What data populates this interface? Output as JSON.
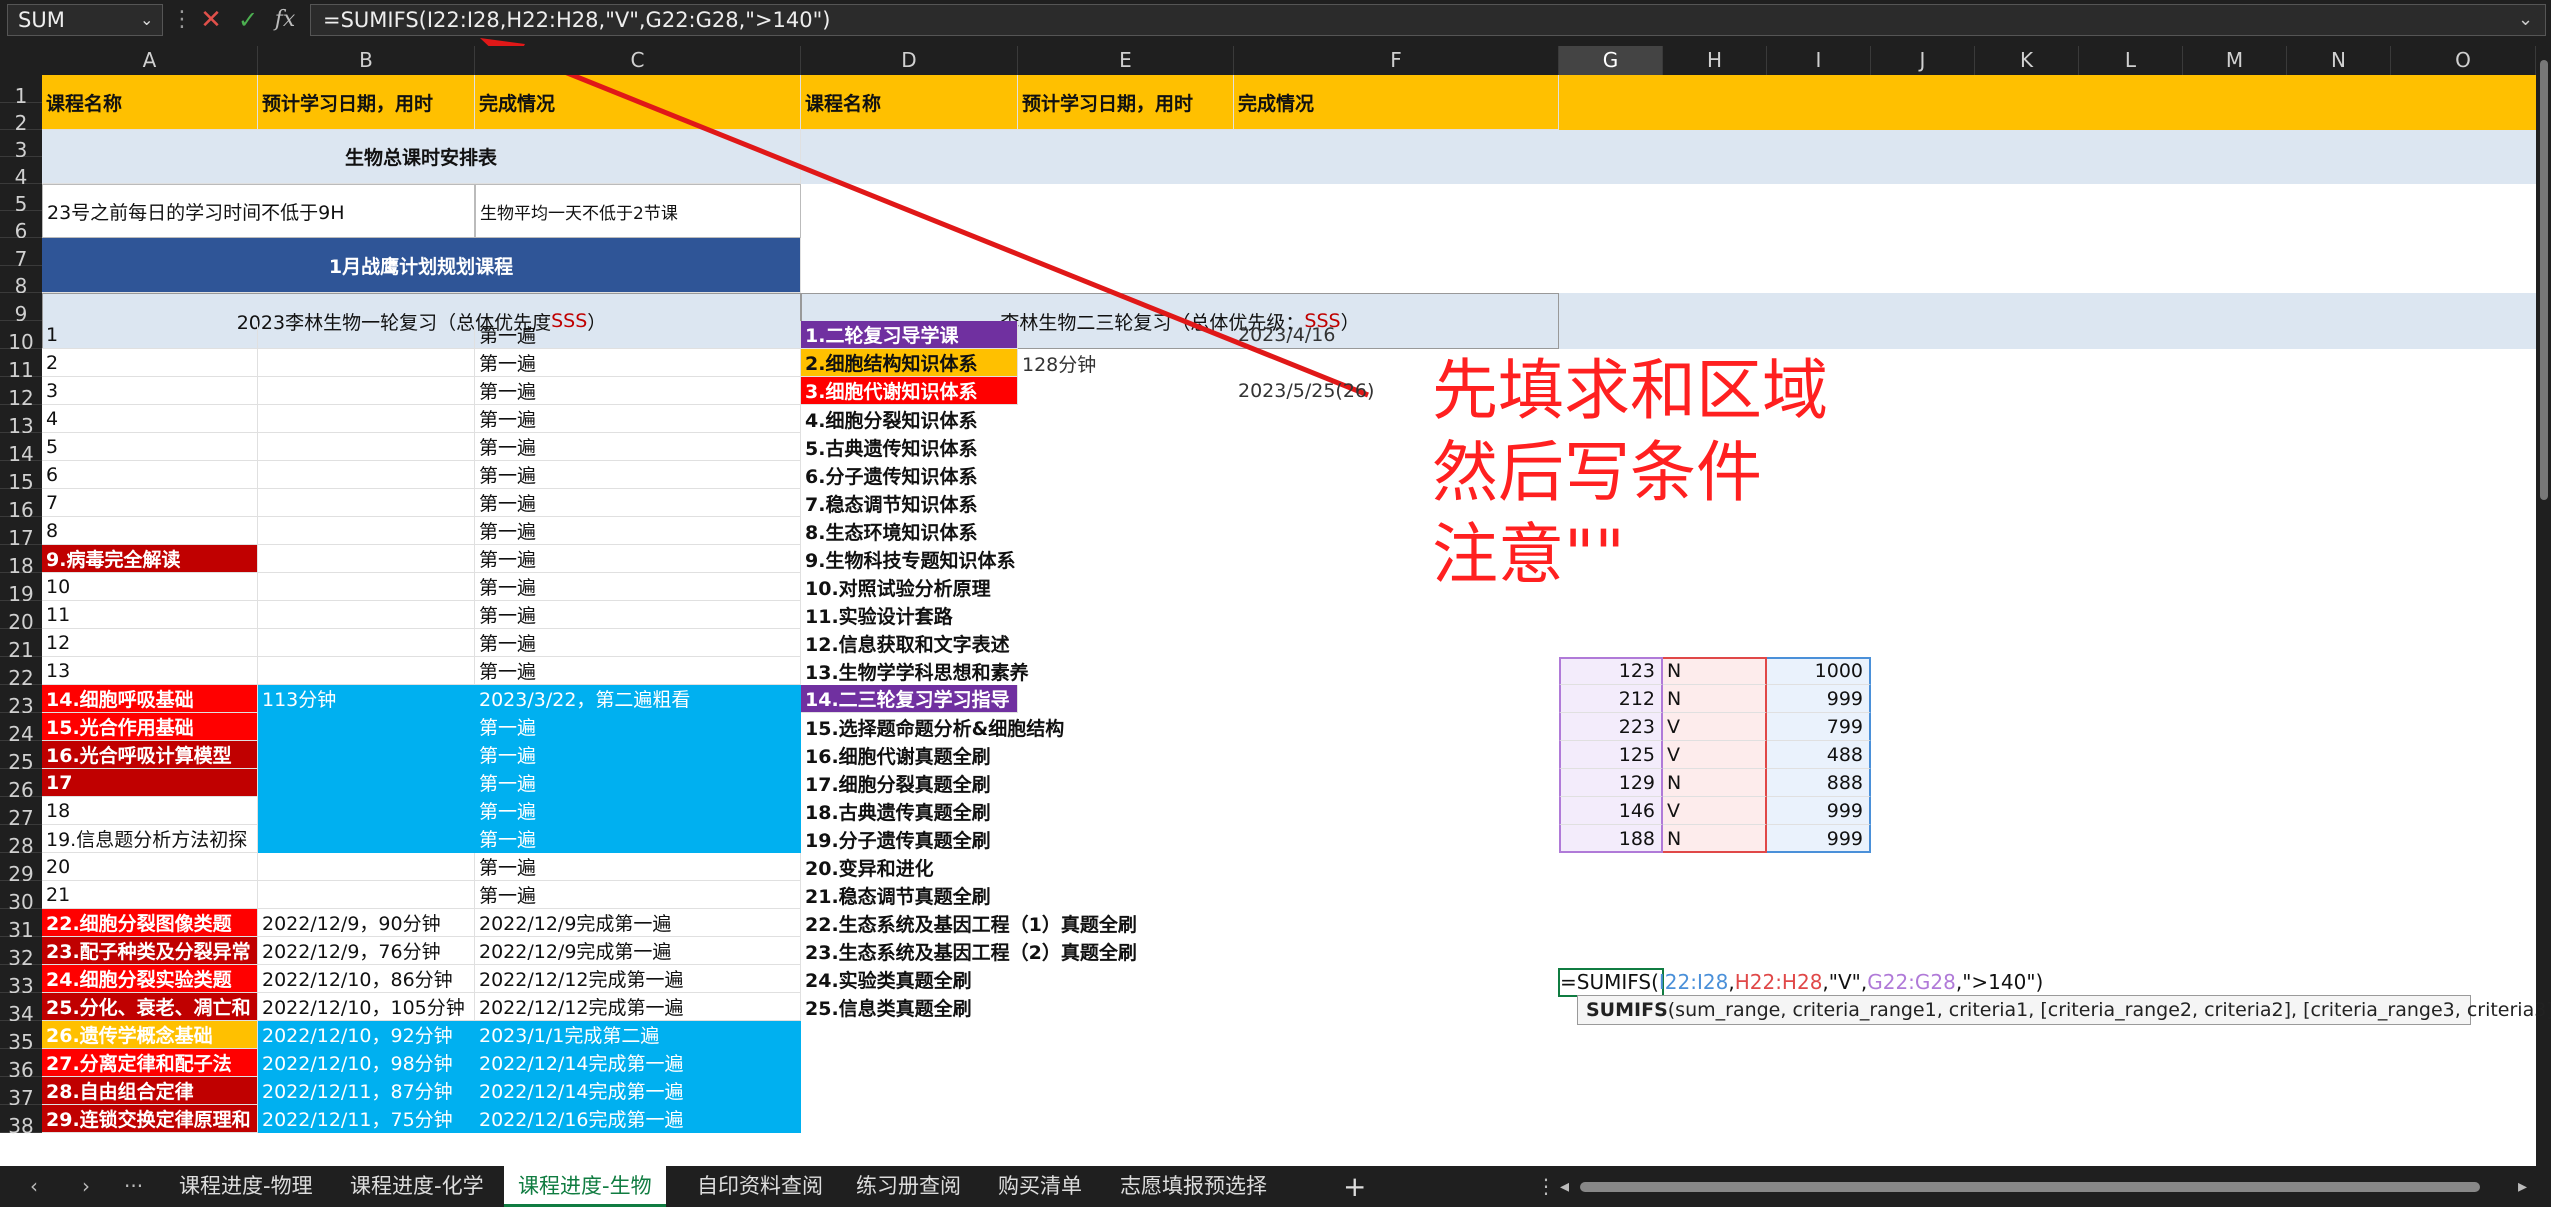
{
  "name_box": "SUM",
  "formula_bar": "=SUMIFS(I22:I28,H22:H28,\"V\",G22:G28,\">140\")",
  "columns": [
    "A",
    "B",
    "C",
    "D",
    "E",
    "F",
    "G",
    "H",
    "I",
    "J",
    "K",
    "L",
    "M",
    "N",
    "O"
  ],
  "header_row": {
    "a": "课程名称",
    "b": "预计学习日期，用时",
    "c": "完成情况",
    "d": "课程名称",
    "e": "预计学习日期，用时",
    "f": "完成情况"
  },
  "row2_title": "生物总课时安排表",
  "row4_a": "23号之前每日的学习时间不低于9H",
  "row4_c": "生物平均一天不低于2节课",
  "row6_title": "1月战鹰计划规划课程",
  "row8_left_text": "2023李林生物一轮复习（总体优先度",
  "row8_left_sss": "SSS",
  "row8_left_close": "）",
  "row8_right_text": "李林生物二三轮复习（总体优先级：",
  "row8_right_sss": "SSS",
  "row8_right_close": "）",
  "rows": [
    {
      "n": "10",
      "a": "1",
      "b": "",
      "c": "第一遍",
      "d": "1.二轮复习导学课",
      "e": "",
      "f": "2023/4/16"
    },
    {
      "n": "11",
      "a": "2",
      "b": "",
      "c": "第一遍",
      "d": "2.细胞结构知识体系",
      "e": "128分钟",
      "f": ""
    },
    {
      "n": "12",
      "a": "3",
      "b": "",
      "c": "第一遍",
      "d": "3.细胞代谢知识体系",
      "e": "",
      "f": "2023/5/25(26)"
    },
    {
      "n": "13",
      "a": "4",
      "b": "",
      "c": "第一遍",
      "d": "4.细胞分裂知识体系",
      "e": "",
      "f": ""
    },
    {
      "n": "14",
      "a": "5",
      "b": "",
      "c": "第一遍",
      "d": "5.古典遗传知识体系",
      "e": "",
      "f": ""
    },
    {
      "n": "15",
      "a": "6",
      "b": "",
      "c": "第一遍",
      "d": "6.分子遗传知识体系",
      "e": "",
      "f": ""
    },
    {
      "n": "16",
      "a": "7",
      "b": "",
      "c": "第一遍",
      "d": "7.稳态调节知识体系",
      "e": "",
      "f": ""
    },
    {
      "n": "17",
      "a": "8",
      "b": "",
      "c": "第一遍",
      "d": "8.生态环境知识体系",
      "e": "",
      "f": ""
    },
    {
      "n": "18",
      "a": "9.病毒完全解读",
      "b": "",
      "c": "第一遍",
      "d": "9.生物科技专题知识体系",
      "e": "",
      "f": ""
    },
    {
      "n": "19",
      "a": "10",
      "b": "",
      "c": "第一遍",
      "d": "10.对照试验分析原理",
      "e": "",
      "f": ""
    },
    {
      "n": "20",
      "a": "11",
      "b": "",
      "c": "第一遍",
      "d": "11.实验设计套路",
      "e": "",
      "f": ""
    },
    {
      "n": "21",
      "a": "12",
      "b": "",
      "c": "第一遍",
      "d": "12.信息获取和文字表述",
      "e": "",
      "f": ""
    },
    {
      "n": "22",
      "a": "13",
      "b": "",
      "c": "第一遍",
      "d": "13.生物学学科思想和素养",
      "e": "",
      "f": ""
    },
    {
      "n": "23",
      "a": "14.细胞呼吸基础",
      "b": "113分钟",
      "c": "2023/3/22，第二遍粗看",
      "d": "14.二三轮复习学习指导",
      "e": "",
      "f": ""
    },
    {
      "n": "24",
      "a": "15.光合作用基础",
      "b": "",
      "c": "第一遍",
      "d": "15.选择题命题分析&细胞结构",
      "e": "",
      "f": ""
    },
    {
      "n": "25",
      "a": "16.光合呼吸计算模型",
      "b": "",
      "c": "第一遍",
      "d": "16.细胞代谢真题全刷",
      "e": "",
      "f": ""
    },
    {
      "n": "26",
      "a": "17",
      "b": "",
      "c": "第一遍",
      "d": "17.细胞分裂真题全刷",
      "e": "",
      "f": ""
    },
    {
      "n": "27",
      "a": "18",
      "b": "",
      "c": "第一遍",
      "d": "18.古典遗传真题全刷",
      "e": "",
      "f": ""
    },
    {
      "n": "28",
      "a": "19.信息题分析方法初探",
      "b": "",
      "c": "第一遍",
      "d": "19.分子遗传真题全刷",
      "e": "",
      "f": ""
    },
    {
      "n": "29",
      "a": "20",
      "b": "",
      "c": "第一遍",
      "d": "20.变异和进化",
      "e": "",
      "f": ""
    },
    {
      "n": "30",
      "a": "21",
      "b": "",
      "c": "第一遍",
      "d": "21.稳态调节真题全刷",
      "e": "",
      "f": ""
    },
    {
      "n": "31",
      "a": "22.细胞分裂图像类题",
      "b": "2022/12/9，90分钟",
      "c": "2022/12/9完成第一遍",
      "d": "22.生态系统及基因工程（1）真题全刷",
      "e": "",
      "f": ""
    },
    {
      "n": "32",
      "a": "23.配子种类及分裂异常",
      "b": "2022/12/9，76分钟",
      "c": "2022/12/9完成第一遍",
      "d": "23.生态系统及基因工程（2）真题全刷",
      "e": "",
      "f": ""
    },
    {
      "n": "33",
      "a": "24.细胞分裂实验类题",
      "b": "2022/12/10，86分钟",
      "c": "2022/12/12完成第一遍",
      "d": "24.实验类真题全刷",
      "e": "",
      "f": ""
    },
    {
      "n": "34",
      "a": "25.分化、衰老、凋亡和",
      "b": "2022/12/10，105分钟",
      "c": "2022/12/12完成第一遍",
      "d": "25.信息类真题全刷",
      "e": "",
      "f": ""
    },
    {
      "n": "35",
      "a": "26.遗传学概念基础",
      "b": "2022/12/10，92分钟",
      "c": "2023/1/1完成第二遍",
      "d": "",
      "e": "",
      "f": ""
    },
    {
      "n": "36",
      "a": "27.分离定律和配子法",
      "b": "2022/12/10，98分钟",
      "c": "2022/12/14完成第一遍",
      "d": "",
      "e": "",
      "f": ""
    },
    {
      "n": "37",
      "a": "28.自由组合定律",
      "b": "2022/12/11，87分钟",
      "c": "2022/12/14完成第一遍",
      "d": "",
      "e": "",
      "f": ""
    },
    {
      "n": "38",
      "a": "29.连锁交换定律原理和",
      "b": "2022/12/11，75分钟",
      "c": "2022/12/16完成第一遍",
      "d": "",
      "e": "",
      "f": ""
    }
  ],
  "ghi_table": [
    {
      "g": "123",
      "h": "N",
      "i": "1000"
    },
    {
      "g": "212",
      "h": "N",
      "i": "999"
    },
    {
      "g": "223",
      "h": "V",
      "i": "799"
    },
    {
      "g": "125",
      "h": "V",
      "i": "488"
    },
    {
      "g": "129",
      "h": "N",
      "i": "888"
    },
    {
      "g": "146",
      "h": "V",
      "i": "999"
    },
    {
      "g": "188",
      "h": "N",
      "i": "999"
    }
  ],
  "edit_formula": {
    "p1": "=SUMIFS(",
    "r1": "I22:I28",
    "c1": ",",
    "r2": "H22:H28",
    "p2": ",\"V\",",
    "r3": "G22:G28",
    "p3": ",\">140\")"
  },
  "tooltip": {
    "fn": "SUMIFS",
    "args": "(sum_range, criteria_range1, criteria1, [criteria_range2, criteria2], [criteria_range3, criteria3], ...)"
  },
  "annotation": "先填求和区域\n然后写条件\n注意\"\"",
  "sheet_tabs": [
    "课程进度-物理",
    "课程进度-化学",
    "课程进度-生物",
    "自印资料查阅",
    "练习册查阅",
    "购买清单",
    "志愿填报预选择"
  ],
  "active_tab": "课程进度-生物",
  "colors": {
    "yellow": "#ffc000",
    "lightblue": "#dce6f1",
    "navy": "#2f5597",
    "darkred": "#c00000",
    "red": "#ff0000",
    "purple": "#7030a0",
    "cyan": "#00b0f0",
    "green": "#107c41"
  }
}
